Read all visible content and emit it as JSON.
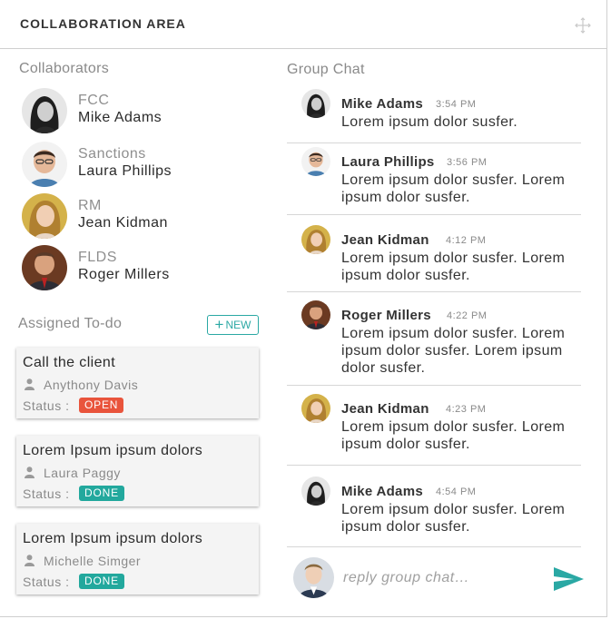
{
  "header": {
    "title": "COLLABORATION AREA",
    "icon": "move-icon"
  },
  "collaborators": {
    "label": "Collaborators",
    "items": [
      {
        "role": "FCC",
        "name": "Mike Adams"
      },
      {
        "role": "Sanctions",
        "name": "Laura Phillips"
      },
      {
        "role": "RM",
        "name": "Jean Kidman"
      },
      {
        "role": "FLDS",
        "name": "Roger Millers"
      }
    ]
  },
  "todo": {
    "label": "Assigned To-do",
    "new_label": "NEW",
    "status_label": "Status :",
    "items": [
      {
        "title": "Call the client",
        "user": "Anythony Davis",
        "status": "OPEN"
      },
      {
        "title": "Lorem Ipsum ipsum dolors",
        "user": "Laura Paggy",
        "status": "DONE"
      },
      {
        "title": "Lorem Ipsum ipsum dolors",
        "user": "Michelle Simger",
        "status": "DONE"
      }
    ]
  },
  "chat": {
    "label": "Group Chat",
    "messages": [
      {
        "name": "Mike Adams",
        "time": "3:54 PM",
        "text": "Lorem ipsum dolor susfer."
      },
      {
        "name": "Laura Phillips",
        "time": "3:56 PM",
        "text": "Lorem ipsum dolor susfer. Lorem ipsum dolor susfer."
      },
      {
        "name": "Jean Kidman",
        "time": "4:12 PM",
        "text": "Lorem ipsum dolor susfer. Lorem ipsum dolor susfer."
      },
      {
        "name": "Roger Millers",
        "time": "4:22 PM",
        "text": "Lorem ipsum dolor susfer. Lorem ipsum dolor susfer. Lorem ipsum dolor susfer."
      },
      {
        "name": "Jean Kidman",
        "time": "4:23 PM",
        "text": "Lorem ipsum dolor susfer. Lorem ipsum dolor susfer."
      },
      {
        "name": "Mike Adams",
        "time": "4:54 PM",
        "text": "Lorem ipsum dolor susfer. Lorem ipsum dolor susfer."
      }
    ],
    "reply_placeholder": "reply group chat…",
    "reply_value": ""
  },
  "colors": {
    "accent": "#2aa8a4",
    "open": "#e9543c",
    "done": "#22a89d"
  }
}
